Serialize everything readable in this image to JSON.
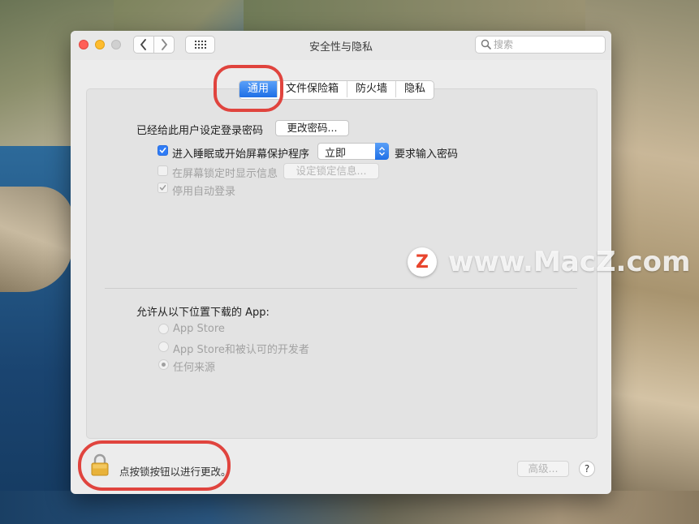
{
  "window": {
    "title": "安全性与隐私"
  },
  "search": {
    "placeholder": "搜索"
  },
  "tabs": [
    {
      "label": "通用",
      "active": true
    },
    {
      "label": "文件保险箱",
      "active": false
    },
    {
      "label": "防火墙",
      "active": false
    },
    {
      "label": "隐私",
      "active": false
    }
  ],
  "general": {
    "password_set_label": "已经给此用户设定登录密码",
    "change_password_button": "更改密码...",
    "require_password": {
      "checked": true,
      "label": "进入睡眠或开始屏幕保护程序",
      "select_value": "立即",
      "suffix": "要求输入密码"
    },
    "show_message": {
      "checked": false,
      "label": "在屏幕锁定时显示信息",
      "button": "设定锁定信息..."
    },
    "disable_auto_login": {
      "checked": true,
      "label": "停用自动登录"
    }
  },
  "downloads": {
    "heading": "允许从以下位置下载的 App:",
    "options": [
      {
        "label": "App Store",
        "selected": false
      },
      {
        "label": "App Store和被认可的开发者",
        "selected": false
      },
      {
        "label": "任何来源",
        "selected": true
      }
    ]
  },
  "footer": {
    "lock_text": "点按锁按钮以进行更改。",
    "advanced_button": "高级...",
    "help_button": "?"
  },
  "watermark": {
    "logo_letter": "Z",
    "text": "www.MacZ.com"
  },
  "colors": {
    "accent": "#2f7cf6",
    "highlight": "#e0443e"
  },
  "icons": [
    "chevron-left-icon",
    "chevron-right-icon",
    "grid-icon",
    "search-icon",
    "lock-icon",
    "checkmark-icon"
  ]
}
